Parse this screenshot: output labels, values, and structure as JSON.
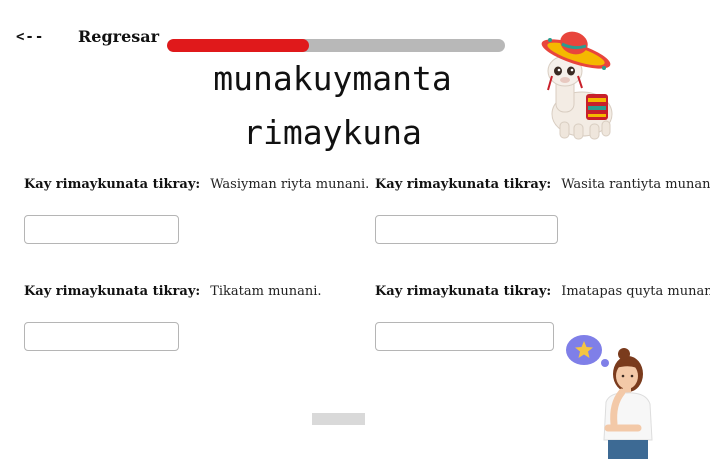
{
  "nav": {
    "back_arrow": "<--",
    "back_label": "Regresar"
  },
  "progress": {
    "fraction": 0.42
  },
  "title": {
    "line1": "munakuymanta",
    "line2": "rimaykuna"
  },
  "exercises": [
    {
      "label": "Kay rimaykunata tikray:",
      "sentence": "Wasiyman riyta munani.",
      "answer": ""
    },
    {
      "label": "Kay rimaykunata tikray:",
      "sentence": "Wasita rantiyta munani.",
      "answer": ""
    },
    {
      "label": "Kay rimaykunata tikray:",
      "sentence": "Tikatam munani.",
      "answer": ""
    },
    {
      "label": "Kay rimaykunata tikray:",
      "sentence": "Imatapas quyta munani.",
      "answer": ""
    }
  ],
  "colors": {
    "accent": "#e0191b",
    "track": "#b8b8b8",
    "input_border": "#b5b5b5",
    "bubble": "#7f7fe8",
    "star": "#f5c542"
  },
  "icons": {
    "mascot": "llama-sombrero-icon",
    "thinker": "thinking-woman-icon",
    "idea": "star-bubble-icon"
  }
}
